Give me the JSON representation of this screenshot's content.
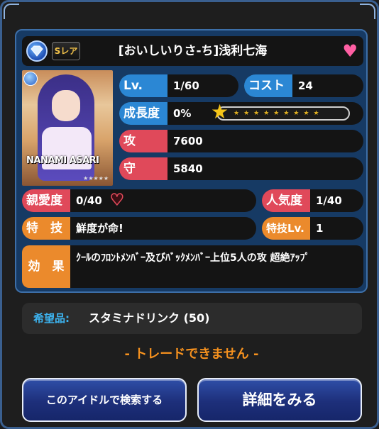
{
  "card": {
    "name": "[おいしいりさ-ち]浅利七海",
    "rarity_badge": "Sレア",
    "portrait_signature": "NANAMI ASARI",
    "portrait_stars": "★★★★★"
  },
  "stats": {
    "level_label": "Lv.",
    "level_value": "1/60",
    "cost_label": "コスト",
    "cost_value": "24",
    "growth_label": "成長度",
    "growth_value": "0%",
    "attack_label": "攻",
    "attack_value": "7600",
    "defense_label": "守",
    "defense_value": "5840",
    "affection_label": "親愛度",
    "affection_value": "0/40",
    "popularity_label": "人気度",
    "popularity_value": "1/40",
    "skill_label": "特　技",
    "skill_value": "鮮度が命!",
    "skill_level_label": "特技Lv.",
    "skill_level_value": "1",
    "effect_label": "効　果",
    "effect_value": "ｸｰﾙのﾌﾛﾝﾄﾒﾝﾊﾞｰ及びﾊﾞｯｸﾒﾝﾊﾞｰ上位5人の攻 超絶ｱｯﾌﾟ"
  },
  "wish": {
    "label": "希望品:",
    "value": "スタミナドリンク (50)"
  },
  "trade_message": "- トレードできません -",
  "buttons": {
    "search_label": "このアイドルで検索する",
    "detail_label": "詳細をみる"
  },
  "colors": {
    "label_blue": "#2b87d4",
    "label_red": "#e0495a",
    "label_orange": "#eb8a2c",
    "trade_message": "#f7921e",
    "wish_label": "#3db4f0"
  }
}
